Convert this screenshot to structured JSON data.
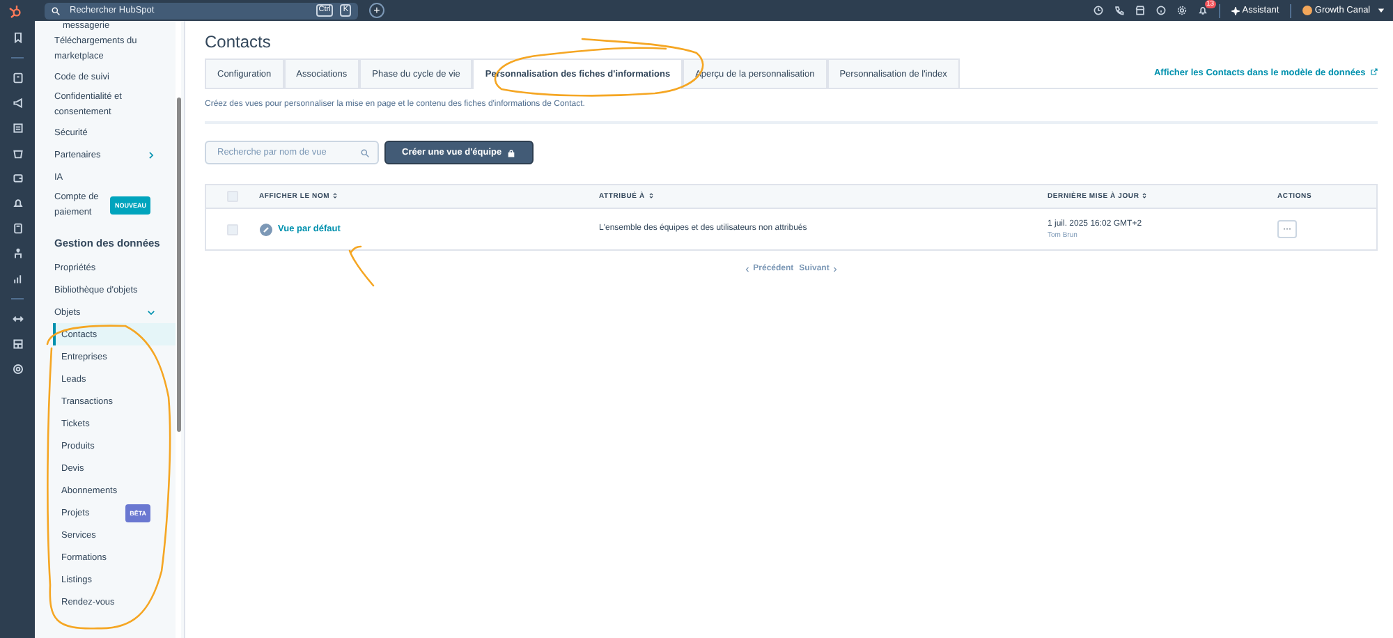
{
  "topbar": {
    "search": {
      "placeholder": "Rechercher HubSpot",
      "keys": [
        "Ctrl",
        "K"
      ]
    },
    "plus": "+",
    "notifications": "13",
    "assistant": "Assistant",
    "account": "Growth Canal"
  },
  "sidebar": {
    "items": [
      {
        "kind": "item",
        "label": "messagerie",
        "selected": false
      },
      {
        "kind": "item",
        "label": "Téléchargements du marketplace",
        "selected": false
      },
      {
        "kind": "item",
        "label": "Code de suivi",
        "selected": false
      },
      {
        "kind": "item",
        "label": "Confidentialité et consentement",
        "selected": false
      },
      {
        "kind": "item",
        "label": "Sécurité",
        "selected": false
      },
      {
        "kind": "group",
        "label": "Partenaires",
        "expanded": false,
        "selected": false
      },
      {
        "kind": "item",
        "label": "IA",
        "selected": false
      },
      {
        "kind": "item",
        "label": "Compte de paiement",
        "badge": {
          "label": "NOUVEAU",
          "color": "#00a4bd"
        },
        "selected": false
      },
      {
        "kind": "heading",
        "label": "Gestion des données"
      },
      {
        "kind": "item",
        "label": "Propriétés",
        "selected": false
      },
      {
        "kind": "item",
        "label": "Bibliothèque d'objets",
        "selected": false
      },
      {
        "kind": "group",
        "label": "Objets",
        "expanded": true,
        "selected": false
      },
      {
        "kind": "sub",
        "label": "Contacts",
        "selected": true
      },
      {
        "kind": "sub",
        "label": "Entreprises",
        "selected": false
      },
      {
        "kind": "sub",
        "label": "Leads",
        "selected": false
      },
      {
        "kind": "sub",
        "label": "Transactions",
        "selected": false
      },
      {
        "kind": "sub",
        "label": "Tickets",
        "selected": false
      },
      {
        "kind": "sub",
        "label": "Produits",
        "selected": false
      },
      {
        "kind": "sub",
        "label": "Devis",
        "selected": false
      },
      {
        "kind": "sub",
        "label": "Abonnements",
        "selected": false
      },
      {
        "kind": "sub",
        "label": "Projets",
        "badge": {
          "label": "BÊTA",
          "color": "#6a78d1"
        },
        "selected": false
      },
      {
        "kind": "sub",
        "label": "Services",
        "selected": false
      },
      {
        "kind": "sub",
        "label": "Formations",
        "selected": false
      },
      {
        "kind": "sub",
        "label": "Listings",
        "selected": false
      },
      {
        "kind": "sub",
        "label": "Rendez-vous",
        "selected": false
      }
    ]
  },
  "page": {
    "title": "Contacts",
    "tabs": [
      {
        "label": "Configuration",
        "selected": false
      },
      {
        "label": "Associations",
        "selected": false
      },
      {
        "label": "Phase du cycle de vie",
        "selected": false
      },
      {
        "label": "Personnalisation des fiches d'informations",
        "selected": true
      },
      {
        "label": "Aperçu de la personnalisation",
        "selected": false
      },
      {
        "label": "Personnalisation de l'index",
        "selected": false
      }
    ],
    "data_model_link": "Afficher les Contacts dans le modèle de données",
    "description": "Créez des vues pour personnaliser la mise en page et le contenu des fiches d'informations de Contact.",
    "search": {
      "placeholder": "Recherche par nom de vue"
    },
    "create_button": "Créer une vue d'équipe",
    "table": {
      "columns": [
        "AFFICHER LE NOM",
        "ATTRIBUÉ À",
        "DERNIÈRE MISE À JOUR",
        "ACTIONS"
      ],
      "all_checked": false,
      "rows": [
        {
          "checked": false,
          "name": "Vue par défaut",
          "assigned": "L'ensemble des équipes et des utilisateurs non attribués",
          "updated": "1 juil. 2025 16:02 GMT+2",
          "updated_by": "Tom Brun",
          "actions": "···"
        }
      ]
    },
    "pagination": {
      "previous": "Précédent",
      "next": "Suivant"
    }
  }
}
